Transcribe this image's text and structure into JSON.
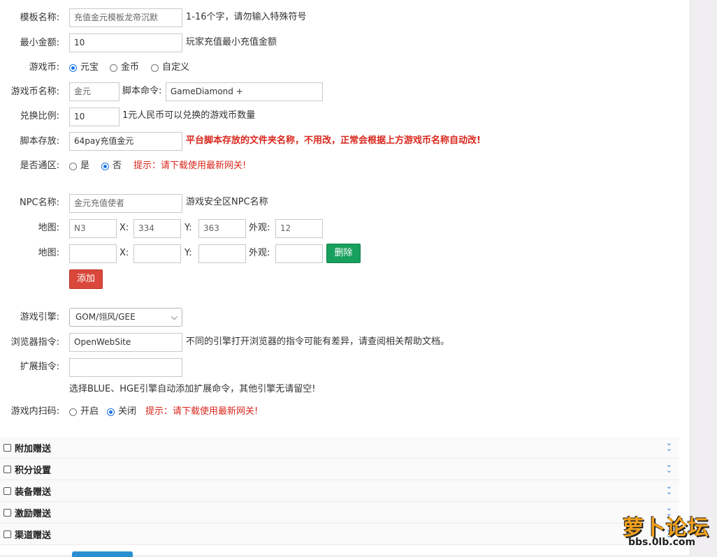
{
  "form": {
    "template_name": {
      "label": "模板名称:",
      "value": "充值金元模板龙帝沉默",
      "hint": "1-16个字，请勿输入特殊符号"
    },
    "min_amount": {
      "label": "最小金额:",
      "value": "10",
      "hint": "玩家充值最小充值金额"
    },
    "currency": {
      "label": "游戏币:",
      "options": [
        "元宝",
        "金币",
        "自定义"
      ],
      "selected": "元宝"
    },
    "currency_name": {
      "label": "游戏币名称:",
      "value": "金元",
      "script_label": "脚本命令:",
      "script_value": "GameDiamond +"
    },
    "exchange_ratio": {
      "label": "兑换比例:",
      "value": "10",
      "hint": "1元人民币可以兑换的游戏币数量"
    },
    "script_storage": {
      "label": "脚本存放:",
      "value": "64pay充值金元",
      "hint": "平台脚本存放的文件夹名称，不用改，正常会根据上方游戏币名称自动改!"
    },
    "all_zones": {
      "label": "是否通区:",
      "options": [
        "是",
        "否"
      ],
      "selected": "否",
      "tip": "提示：请下载使用最新网关!"
    },
    "npc_name": {
      "label": "NPC名称:",
      "value": "金元充值使者",
      "hint": "游戏安全区NPC名称"
    },
    "map_rows": [
      {
        "label": "地图:",
        "map": "N3",
        "x_label": "X:",
        "x": "334",
        "y_label": "Y:",
        "y": "363",
        "look_label": "外观:",
        "look": "12"
      },
      {
        "label": "地图:",
        "map": "",
        "x_label": "X:",
        "x": "",
        "y_label": "Y:",
        "y": "",
        "look_label": "外观:",
        "look": "",
        "delete_label": "删除"
      }
    ],
    "add_label": "添加",
    "engine": {
      "label": "游戏引擎:",
      "value": "GOM/翎风/GEE"
    },
    "browser_cmd": {
      "label": "浏览器指令:",
      "value": "OpenWebSite",
      "hint": "不同的引擎打开浏览器的指令可能有差异，请查阅相关帮助文档。"
    },
    "ext_cmd": {
      "label": "扩展指令:",
      "value": "",
      "hint": "选择BLUE、HGE引擎自动添加扩展命令，其他引擎无请留空!"
    },
    "scan_code": {
      "label": "游戏内扫码:",
      "options": [
        "开启",
        "关闭"
      ],
      "selected": "关闭",
      "tip": "提示：请下载使用最新网关!"
    }
  },
  "sections": [
    {
      "title": "附加赠送"
    },
    {
      "title": "积分设置"
    },
    {
      "title": "装备赠送"
    },
    {
      "title": "激励赠送"
    },
    {
      "title": "渠道赠送"
    }
  ],
  "watermark": {
    "main": "萝卜论坛",
    "url": "bbs.0lb.com"
  },
  "colors": {
    "accent": "#1a73e8",
    "warning": "#d9261c",
    "delete_button": "#18a05e",
    "add_button": "#d9483b",
    "chevron": "#2d7bd6"
  }
}
